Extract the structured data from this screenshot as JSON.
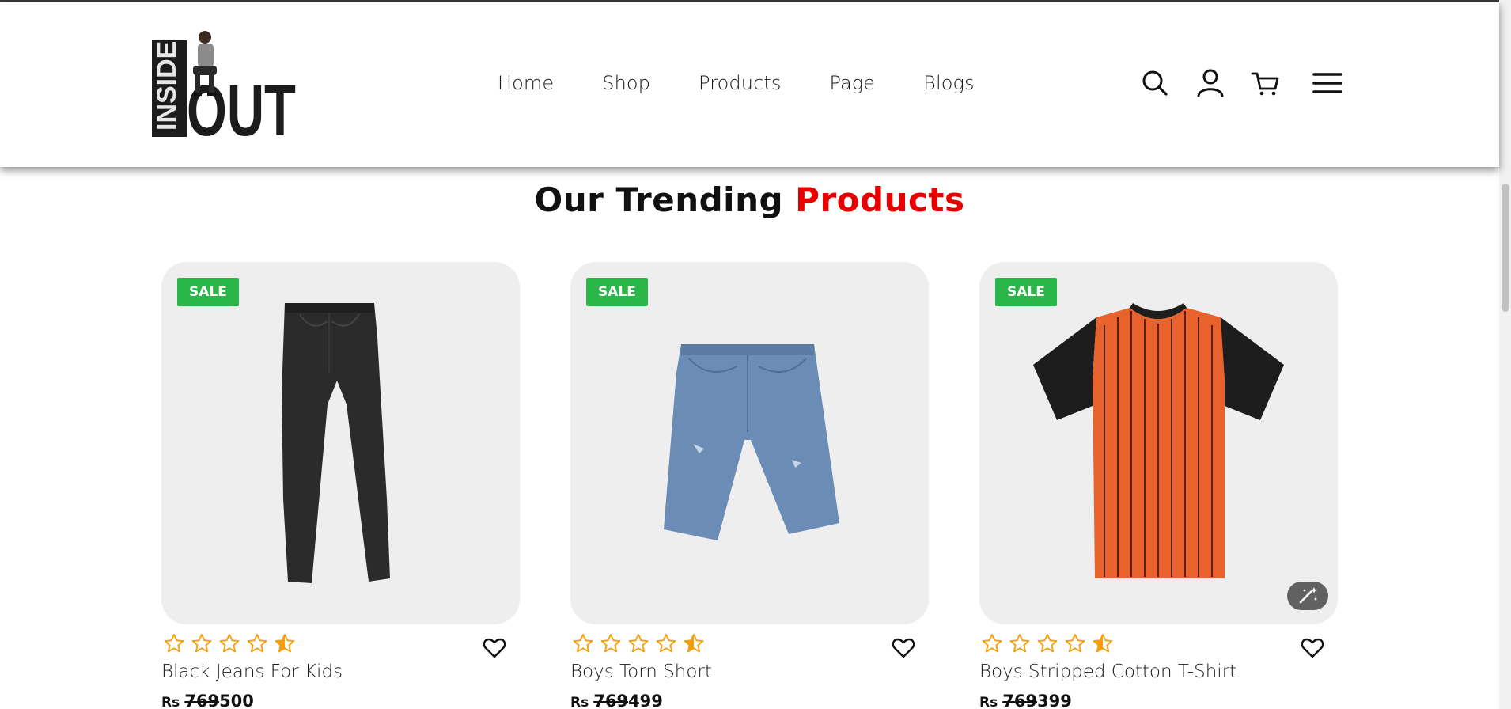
{
  "header": {
    "logo": {
      "text_top": "INSIDE",
      "text_main": "OUT"
    },
    "nav": [
      {
        "label": "Home"
      },
      {
        "label": "Shop"
      },
      {
        "label": "Products"
      },
      {
        "label": "Page"
      },
      {
        "label": "Blogs"
      }
    ],
    "icons": [
      "search-icon",
      "user-icon",
      "cart-icon",
      "menu-icon"
    ]
  },
  "section": {
    "title_part1": "Our Trending",
    "title_part2": "Products",
    "accent_color": "#e80000"
  },
  "products": [
    {
      "badge": "SALE",
      "name": "Black Jeans For Kids",
      "currency": "Rs",
      "old_price": "769",
      "price": "500",
      "rating": 4.5
    },
    {
      "badge": "SALE",
      "name": "Boys Torn Short",
      "currency": "Rs",
      "old_price": "769",
      "price": "499",
      "rating": 4.5
    },
    {
      "badge": "SALE",
      "name": "Boys Stripped Cotton T-Shirt",
      "currency": "Rs",
      "old_price": "769",
      "price": "399",
      "rating": 4.5
    }
  ],
  "colors": {
    "sale_badge": "#2bb64a",
    "star": "#f59e0b",
    "card_bg": "#eeeeee"
  }
}
